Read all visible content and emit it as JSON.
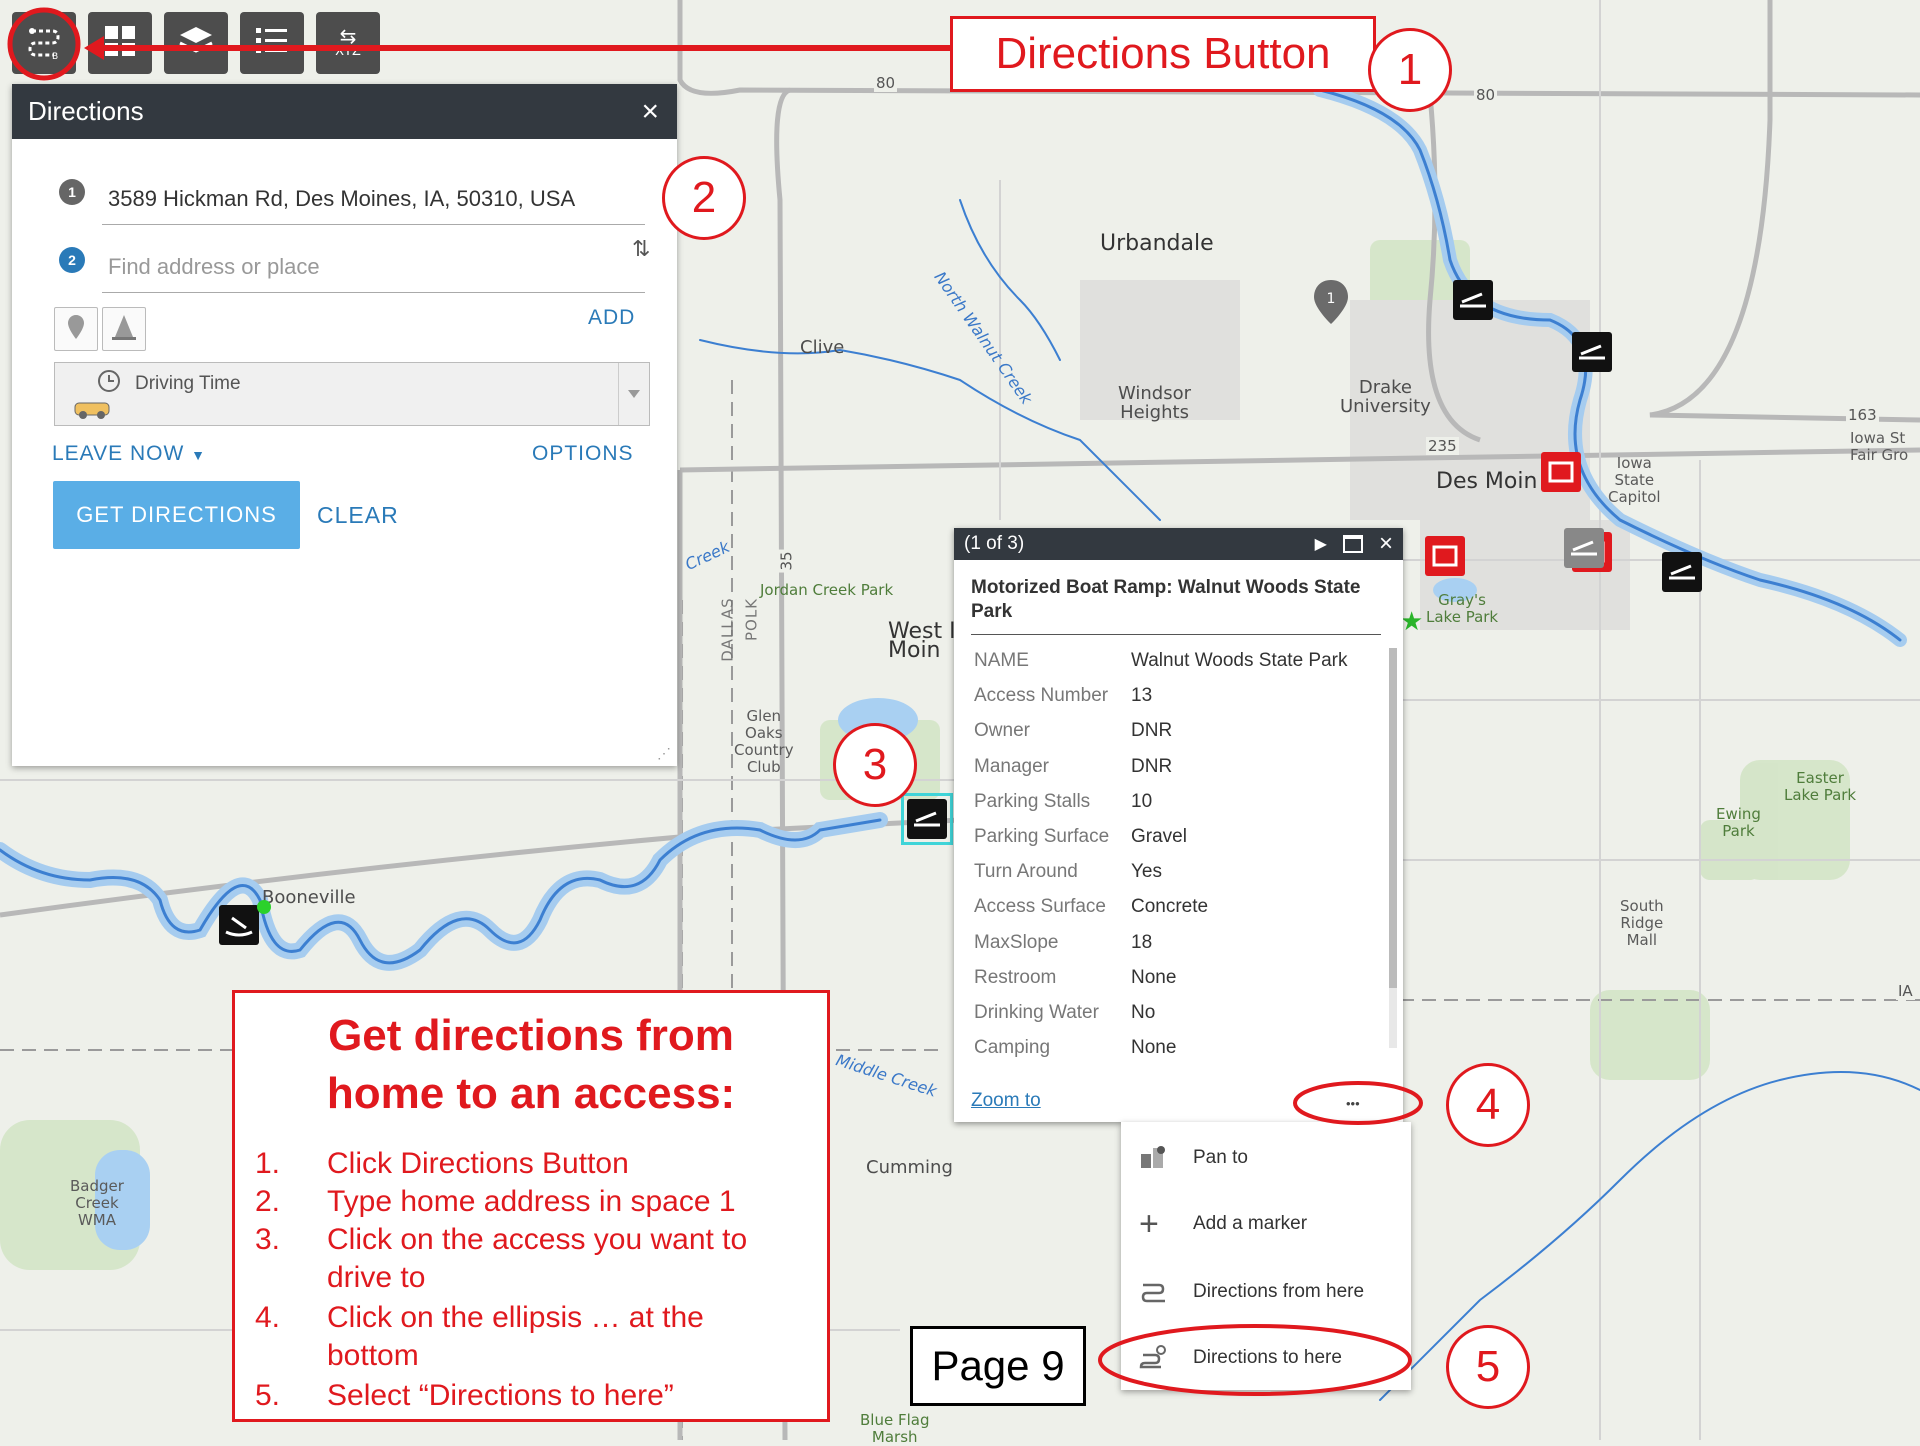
{
  "toolbar": {
    "buttons": [
      {
        "icon": "directions-icon"
      },
      {
        "icon": "basemap-gallery-icon"
      },
      {
        "icon": "layers-icon"
      },
      {
        "icon": "legend-list-icon"
      },
      {
        "icon": "coordinate-xyz-icon",
        "text": "XYZ"
      }
    ]
  },
  "map_labels": {
    "urbandale": "Urbandale",
    "clive": "Clive",
    "windsor_heights": "Windsor\nHeights",
    "drake_university": "Drake\nUniversity",
    "des_moines": "Des Moin",
    "iowa_state_capitol": "Iowa\nState\nCapitol",
    "iowa_state_fair": "Iowa St\nFair Gro",
    "grays_lake_park": "Gray's\nLake Park",
    "west_des_moines": "West I\nMoin",
    "jordan_creek_park": "Jordan Creek Park",
    "glen_oaks": "Glen\nOaks\nCountry\nClub",
    "booneville": "Booneville",
    "cumming": "Cumming",
    "badger_creek": "Badger\nCreek\nWMA",
    "easter_lake_park": "Easter\nLake Park",
    "ewing_park": "Ewing\nPark",
    "south_ridge_mall": "South\nRidge\nMall",
    "blue_flag_marsh": "Blue Flag\nMarsh",
    "north_walnut_creek": "North Walnut Creek",
    "middle_creek": "Middle Creek",
    "creek": "Creek",
    "dallas": "DALLAS",
    "polk": "POLK",
    "hwy_80_left": "80",
    "hwy_80_right": "80",
    "hwy_235": "235",
    "hwy_163": "163",
    "hwy_35": "35",
    "ia": "IA",
    "marker_1": "1"
  },
  "directions_panel": {
    "title": "Directions",
    "close": "×",
    "stop1_number": "1",
    "stop1_value": "3589 Hickman Rd, Des Moines, IA, 50310, USA",
    "stop2_number": "2",
    "stop2_placeholder": "Find address or place",
    "swap_icon": "⇅",
    "add_label": "ADD",
    "travel_mode": "Driving Time",
    "leave_now": "LEAVE NOW",
    "options": "OPTIONS",
    "get_directions": "GET DIRECTIONS",
    "clear": "CLEAR"
  },
  "popup": {
    "counter": "(1 of 3)",
    "title": "Motorized Boat Ramp: Walnut Woods State Park",
    "rows": [
      {
        "key": "NAME",
        "value": "Walnut Woods State Park"
      },
      {
        "key": "Access Number",
        "value": "13"
      },
      {
        "key": "Owner",
        "value": "DNR"
      },
      {
        "key": "Manager",
        "value": "DNR"
      },
      {
        "key": "Parking Stalls",
        "value": "10"
      },
      {
        "key": "Parking Surface",
        "value": "Gravel"
      },
      {
        "key": "Turn Around",
        "value": "Yes"
      },
      {
        "key": "Access Surface",
        "value": "Concrete"
      },
      {
        "key": "MaxSlope",
        "value": "18"
      },
      {
        "key": "Restroom",
        "value": "None"
      },
      {
        "key": "Drinking Water",
        "value": "No"
      },
      {
        "key": "Camping",
        "value": "None"
      }
    ],
    "zoom_to": "Zoom to",
    "ellipsis": "•••"
  },
  "menu": {
    "items": [
      {
        "label": "Pan to",
        "icon": "pan-icon"
      },
      {
        "label": "Add a marker",
        "icon": "plus-icon"
      },
      {
        "label": "Directions from here",
        "icon": "directions-from-icon"
      },
      {
        "label": "Directions to here",
        "icon": "directions-to-icon"
      }
    ]
  },
  "annotations": {
    "directions_button_label": "Directions Button",
    "callouts": [
      "1",
      "2",
      "3",
      "4",
      "5"
    ],
    "instructions_title": "Get directions from home to an access:",
    "steps": [
      {
        "n": "1.",
        "text": "Click Directions Button"
      },
      {
        "n": "2.",
        "text": "Type home address in space 1"
      },
      {
        "n": "3.",
        "text": "Click on the access you want to drive to"
      },
      {
        "n": "4.",
        "text": "Click on the ellipsis … at the bottom"
      },
      {
        "n": "5.",
        "text": "Select “Directions to here”"
      }
    ],
    "page_label": "Page 9"
  },
  "colors": {
    "annotation_red": "#e0191e",
    "panel_header": "#333940",
    "link_blue": "#2a7ab8",
    "button_blue": "#5aaee6",
    "river_blue": "#5fa8e6"
  }
}
